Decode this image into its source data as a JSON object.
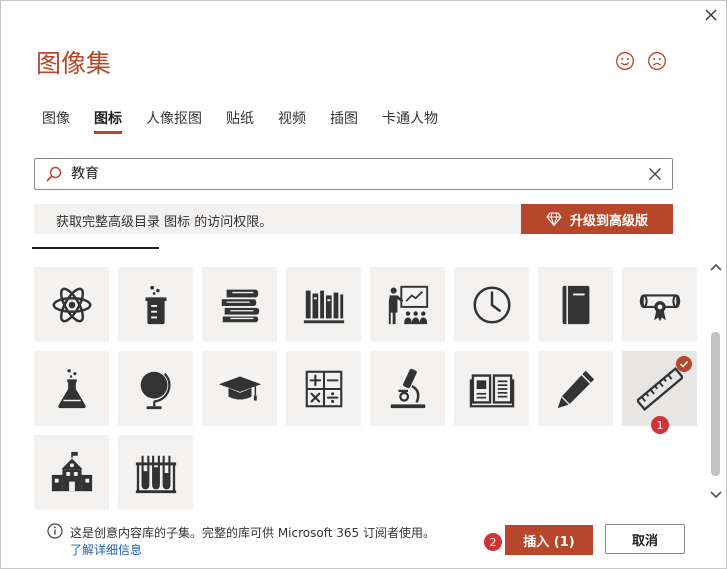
{
  "dialog": {
    "title": "图像集",
    "colors": {
      "accent": "#b7472a",
      "badge": "#d13438",
      "tile_bg": "#f3f2f1",
      "link": "#1f5fb0"
    }
  },
  "tabs": [
    {
      "label": "图像",
      "active": false
    },
    {
      "label": "图标",
      "active": true
    },
    {
      "label": "人像抠图",
      "active": false
    },
    {
      "label": "贴纸",
      "active": false
    },
    {
      "label": "视频",
      "active": false
    },
    {
      "label": "插图",
      "active": false
    },
    {
      "label": "卡通人物",
      "active": false
    }
  ],
  "search": {
    "value": "教育",
    "placeholder": "搜索"
  },
  "banner": {
    "text": "获取完整高级目录 图标 的访问权限。",
    "upgrade_label": "升级到高级版"
  },
  "icons": [
    {
      "name": "atom-icon",
      "selected": false
    },
    {
      "name": "beaker-icon",
      "selected": false
    },
    {
      "name": "books-stack-icon",
      "selected": false
    },
    {
      "name": "bookshelf-icon",
      "selected": false
    },
    {
      "name": "classroom-teacher-icon",
      "selected": false
    },
    {
      "name": "clock-icon",
      "selected": false
    },
    {
      "name": "notebook-icon",
      "selected": false
    },
    {
      "name": "diploma-icon",
      "selected": false
    },
    {
      "name": "flask-icon",
      "selected": false
    },
    {
      "name": "globe-icon",
      "selected": false
    },
    {
      "name": "graduation-cap-icon",
      "selected": false
    },
    {
      "name": "calculator-icon",
      "selected": false
    },
    {
      "name": "microscope-icon",
      "selected": false
    },
    {
      "name": "open-book-icon",
      "selected": false
    },
    {
      "name": "pencil-icon",
      "selected": false
    },
    {
      "name": "ruler-icon",
      "selected": true
    },
    {
      "name": "school-icon",
      "selected": false
    },
    {
      "name": "test-tubes-icon",
      "selected": false
    }
  ],
  "badges": {
    "step1": "1",
    "step2": "2"
  },
  "footer": {
    "info_text": "这是创意内容库的子集。完整的库可供 Microsoft 365 订阅者使用。",
    "link_text": "了解详细信息",
    "insert_label": "插入 (1)",
    "cancel_label": "取消"
  }
}
